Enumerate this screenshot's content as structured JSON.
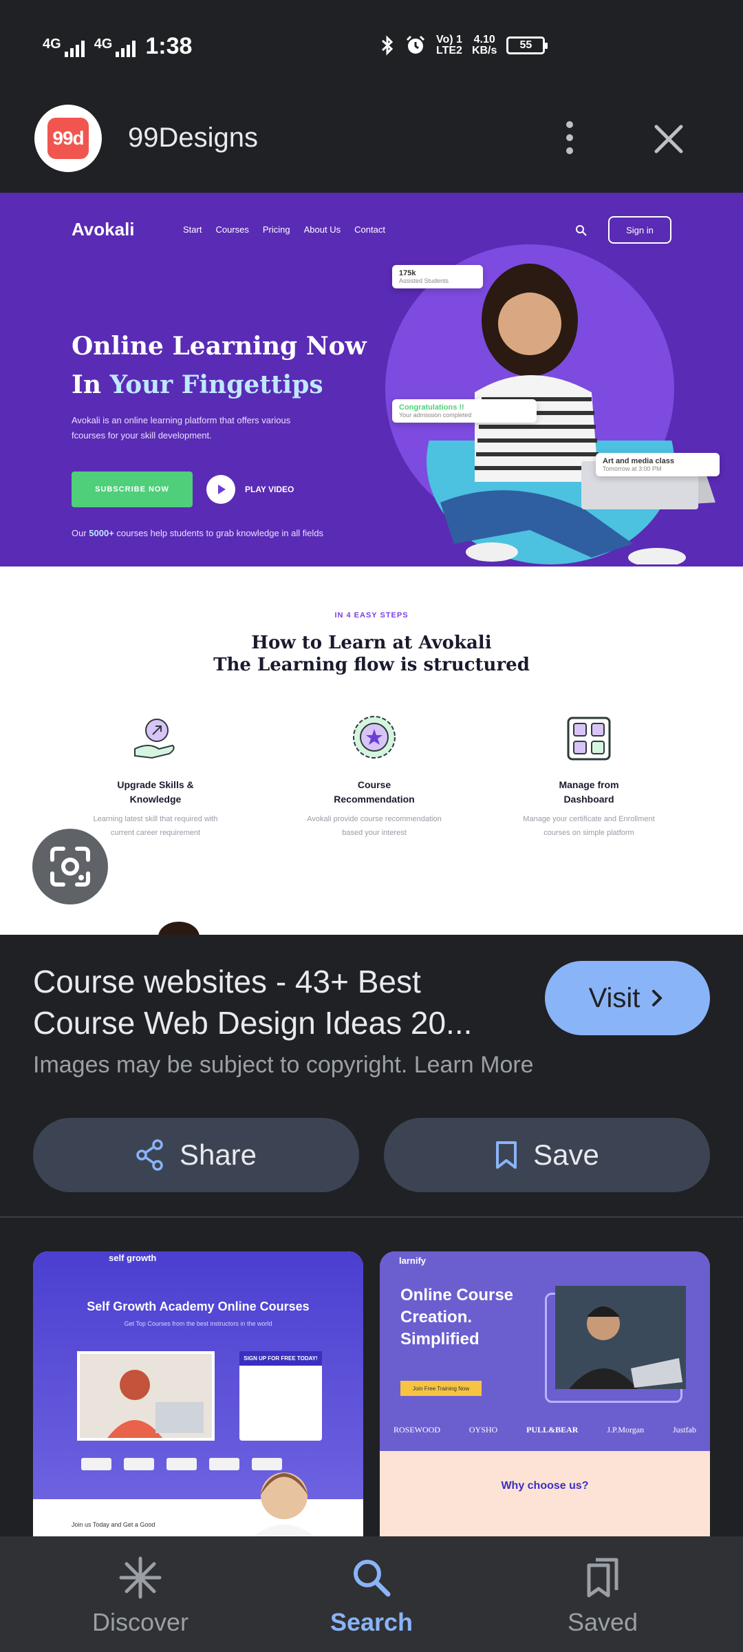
{
  "status_bar": {
    "net1": "4G",
    "net2": "4G",
    "time": "1:38",
    "volte": "Vo) 1",
    "lte": "LTE2",
    "speed": "4.10",
    "speed_unit": "KB/s",
    "battery": "55"
  },
  "header": {
    "logo_text": "99d",
    "site_name": "99Designs"
  },
  "preview": {
    "brand": "Avokali",
    "nav_links": [
      "Start",
      "Courses",
      "Pricing",
      "About Us",
      "Contact"
    ],
    "signin": "Sign in",
    "headline_1": "Online Learning Now",
    "headline_2a": "In ",
    "headline_2b": "Your Fingettips",
    "subtext_1": "Avokali is an online learning platform that offers various",
    "subtext_2": "fcourses for your skill development.",
    "cta": "SUBSCRIBE NOW",
    "play": "PLAY VIDEO",
    "note_a": "Our ",
    "note_b": "5000+",
    "note_c": " courses help students to grab knowledge in all fields",
    "card1_title": "175k",
    "card1_sub": "Assisted Students",
    "card2_title": "Congratulations !!",
    "card2_sub": "Your admission completed",
    "card3_title": "Art and media class",
    "card3_sub": "Tomorrow at 3:00 PM",
    "steps_kicker": "IN 4 EASY STEPS",
    "steps_title_1": "How to Learn at Avokali",
    "steps_title_2": "The Learning flow is structured",
    "steps": [
      {
        "title_1": "Upgrade Skills &",
        "title_2": "Knowledge",
        "desc_1": "Learning latest skill that required with",
        "desc_2": "current career requirement"
      },
      {
        "title_1": "Course",
        "title_2": "Recommendation",
        "desc_1": "Avokali provide course recommendation",
        "desc_2": "based your interest"
      },
      {
        "title_1": "Manage from",
        "title_2": "Dashboard",
        "desc_1": "Manage your certificate and Enrollment",
        "desc_2": "courses on simple platform"
      }
    ]
  },
  "result": {
    "title": "Course websites - 43+ Best Course Web Design Ideas 20...",
    "visit": "Visit",
    "copyright": "Images may be subject to copyright. Learn More",
    "share": "Share",
    "save": "Save"
  },
  "related": [
    {
      "brand": "self growth",
      "headline": "Self Growth Academy Online Courses",
      "sub": "Get Top Courses from the best instructors in the world",
      "signup": "SIGN UP FOR FREE TODAY!",
      "footer": "Join us Today and Get a Good"
    },
    {
      "brand": "larnify",
      "headline_1": "Online Course",
      "headline_2": "Creation.",
      "headline_3": "Simplified",
      "cta": "Join Free Training Now",
      "logos": [
        "ROSEWOOD",
        "OYSHO",
        "PULL&BEAR",
        "J.P.Morgan",
        "Justfab"
      ],
      "section": "Why choose us?"
    }
  ],
  "bottom_nav": {
    "discover": "Discover",
    "search": "Search",
    "saved": "Saved"
  },
  "colors": {
    "accent": "#8ab4f8",
    "background": "#202124",
    "button": "#3c4454",
    "hero_purple": "#5a2bb5"
  }
}
